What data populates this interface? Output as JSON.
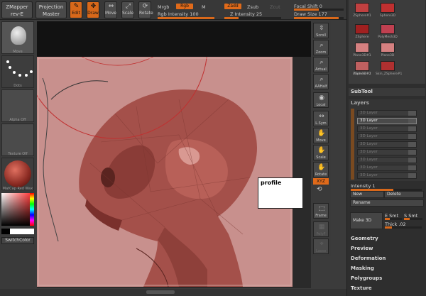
{
  "header": {
    "app_name": "ZMapper",
    "app_version": "rev-E",
    "projection_label": "Projection",
    "projection_value": "Master",
    "edit_label": "Edit",
    "draw_label": "Draw",
    "move_label": "Move",
    "scale_label": "Scale",
    "rotate_label": "Rotate",
    "mrgb_label": "Mrgb",
    "rgb_label": "Rgb",
    "m_label": "M",
    "rgb_intensity_label": "Rgb Intensity",
    "rgb_intensity_value": "100",
    "zadd_label": "Zadd",
    "zsub_label": "Zsub",
    "zcut_label": "Zcut",
    "z_intensity_label": "Z Intensity",
    "z_intensity_value": "25",
    "focal_shift_label": "Focal Shift",
    "focal_shift_value": "0",
    "draw_size_label": "Draw Size",
    "draw_size_value": "177",
    "rgb_intensity_level": 1.0,
    "z_intensity_level": 0.25,
    "focal_level": 0.5,
    "draw_size_level": 0.9
  },
  "left_shelf": {
    "brush_label": "Move",
    "stroke_label": "Dots",
    "alpha_label": "Alpha Off",
    "texture_label": "Texture Off",
    "material_label": "MatCap Red Wax",
    "switch_color_label": "SwitchColor"
  },
  "right_shelf": {
    "scroll": "Scroll",
    "zoom": "Zoom",
    "actual": "Actual",
    "aahalf": "AAHalf",
    "local": "Local",
    "lsym": "L.Sym",
    "move": "Move",
    "scale": "Scale",
    "rotate": "Rotate",
    "xyz": "XYZ",
    "frame": "Frame",
    "poly": "PolyF",
    "lasso": "Lasso"
  },
  "canvas": {
    "profile_note": "profile"
  },
  "tool_palette": {
    "tools": [
      {
        "label": "ZSphere#1"
      },
      {
        "label": "Sphere3D"
      },
      {
        "label": "ZSphere"
      },
      {
        "label": "PolyMesh3D"
      },
      {
        "label": "Plane3D#1"
      },
      {
        "label": "Plane3D"
      },
      {
        "label": "Plane3D#2"
      },
      {
        "label": "Skin_ZSphere#1"
      },
      {
        "label": "ZSphere#1"
      }
    ],
    "subtool_label": "SubTool",
    "layers_label": "Layers",
    "layers": [
      {
        "label": "3D Layer",
        "active": false
      },
      {
        "label": "3D Layer",
        "active": true
      },
      {
        "label": "3D Layer",
        "active": false
      },
      {
        "label": "3D Layer",
        "active": false
      },
      {
        "label": "3D Layer",
        "active": false
      },
      {
        "label": "3D Layer",
        "active": false
      },
      {
        "label": "3D Layer",
        "active": false
      },
      {
        "label": "3D Layer",
        "active": false
      },
      {
        "label": "3D Layer",
        "active": false
      }
    ],
    "intensity_label": "Intensity",
    "intensity_value": "1",
    "new_label": "New",
    "delete_label": "Delete",
    "rename_label": "Rename",
    "make3d_label": "Make 3D",
    "esmt_label": "E Smt",
    "ssmt_label": "S Smt",
    "thick_label": "Thick",
    "thick_value": ".02",
    "menus": [
      "Geometry",
      "Preview",
      "Deformation",
      "Masking",
      "Polygroups",
      "Texture"
    ]
  },
  "colors": {
    "accent": "#d8681a",
    "viewport": "#c8908d",
    "model": "#a04a44"
  }
}
